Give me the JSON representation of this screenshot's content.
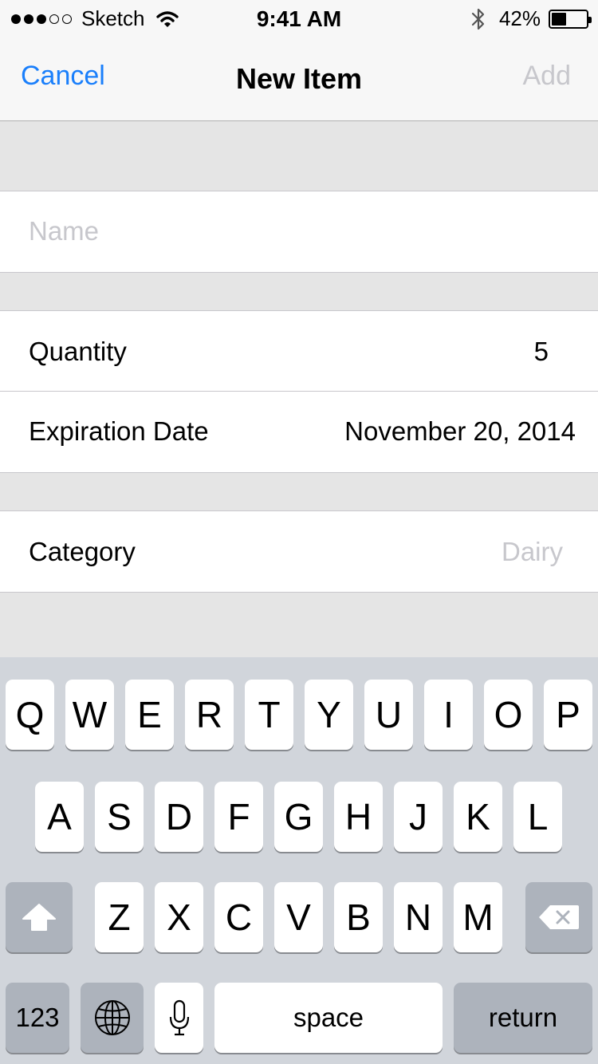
{
  "status_bar": {
    "carrier": "Sketch",
    "time": "9:41 AM",
    "battery_percent": "42%",
    "battery_level": 0.42,
    "signal_bars_filled": 3,
    "signal_bars_total": 5
  },
  "nav": {
    "cancel_label": "Cancel",
    "title": "New Item",
    "add_label": "Add"
  },
  "form": {
    "name_placeholder": "Name",
    "name_value": "",
    "quantity_label": "Quantity",
    "quantity_value": "5",
    "expiration_label": "Expiration Date",
    "expiration_value": "November 20, 2014",
    "category_label": "Category",
    "category_value": "Dairy"
  },
  "keyboard": {
    "row1": [
      "Q",
      "W",
      "E",
      "R",
      "T",
      "Y",
      "U",
      "I",
      "O",
      "P"
    ],
    "row2": [
      "A",
      "S",
      "D",
      "F",
      "G",
      "H",
      "J",
      "K",
      "L"
    ],
    "row3": [
      "Z",
      "X",
      "C",
      "V",
      "B",
      "N",
      "M"
    ],
    "numbers_label": "123",
    "space_label": "space",
    "return_label": "return"
  },
  "colors": {
    "accent": "#1a7ffb",
    "disabled": "#c7c7cc",
    "group_background": "#e5e5e5",
    "keyboard_background": "#d1d5db",
    "function_key": "#adb3bc"
  }
}
